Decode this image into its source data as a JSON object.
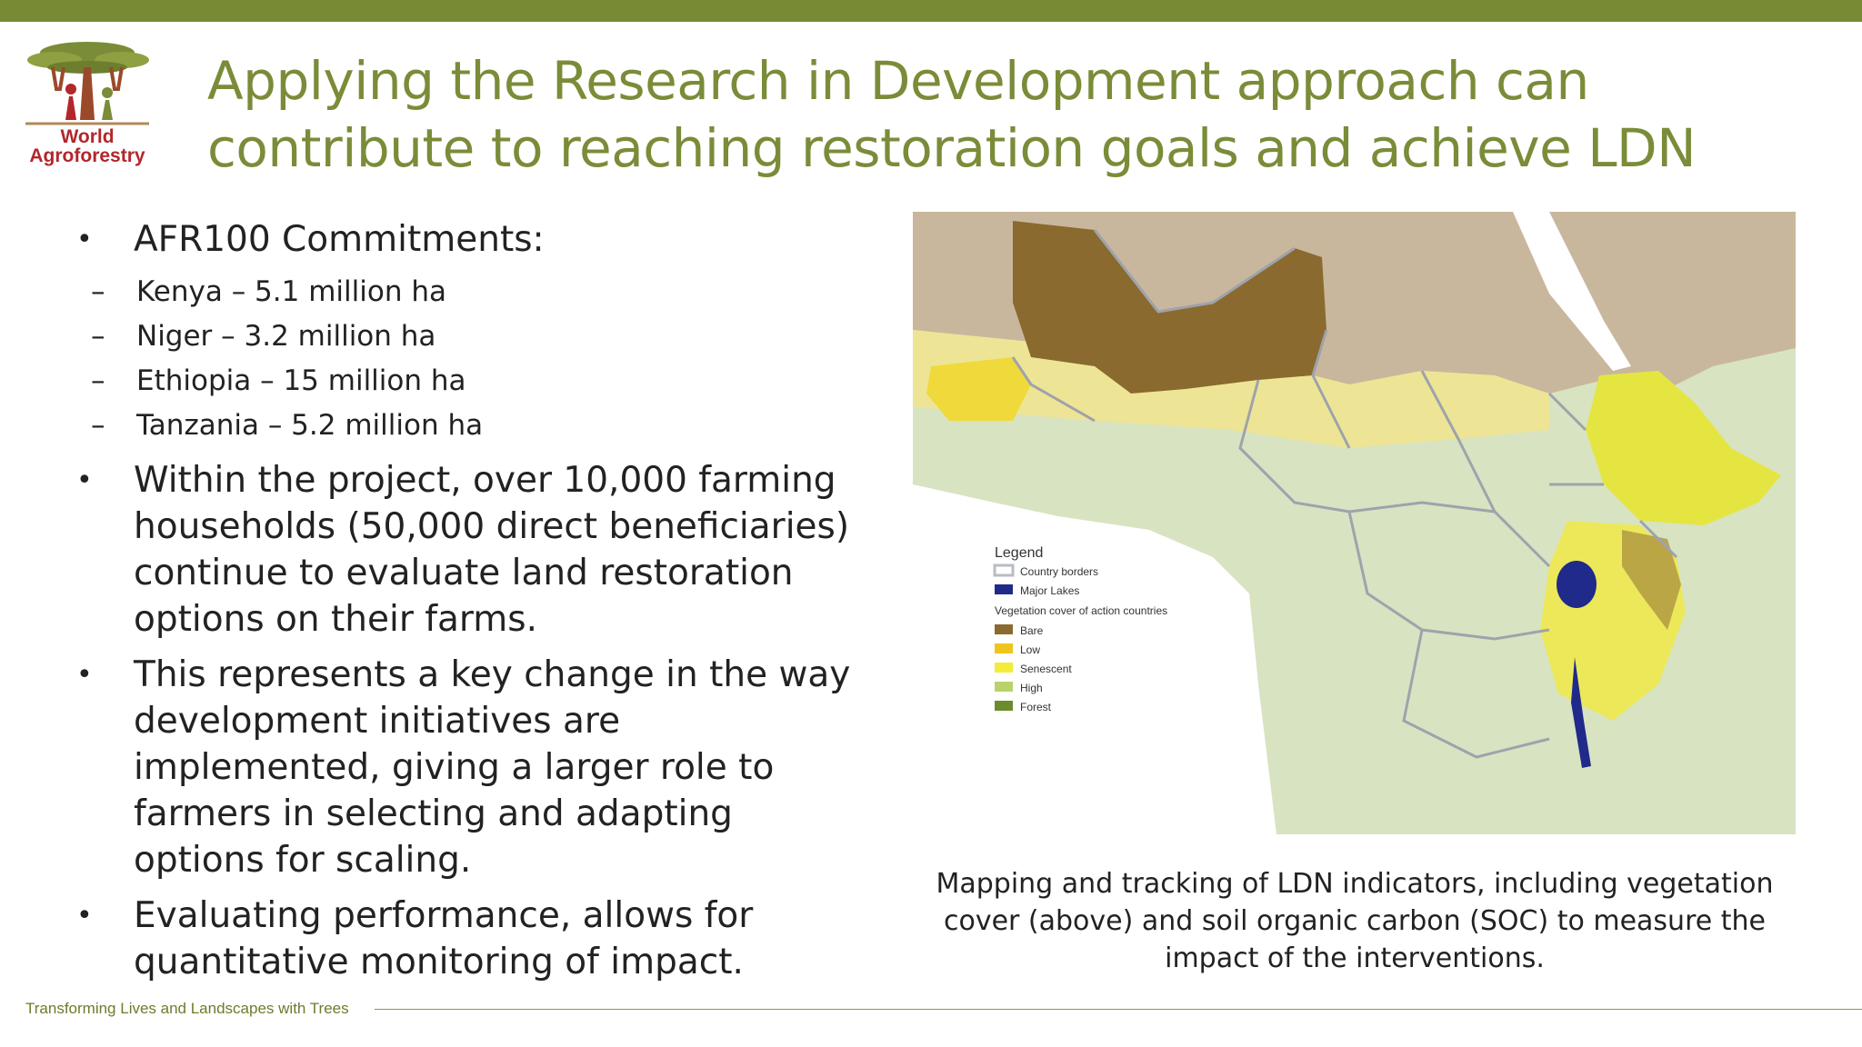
{
  "brand": {
    "logo_line1": "World",
    "logo_line2": "Agroforestry",
    "accent_color": "#788a34",
    "logo_red": "#b3262b"
  },
  "title": {
    "line1": "Applying the Research in Development approach can",
    "line2": "contribute to reaching restoration goals and achieve LDN"
  },
  "bullets": {
    "b1": "AFR100 Commitments:",
    "sub": [
      "Kenya – 5.1  million ha",
      "Niger – 3.2 million ha",
      "Ethiopia – 15 million ha",
      "Tanzania – 5.2 million ha"
    ],
    "b2": "Within the project, over 10,000 farming households (50,000 direct beneficiaries) continue to evaluate land restoration options on their farms.",
    "b3": "This represents a key change in the way development initiatives are implemented, giving a larger role to farmers in selecting and adapting options for scaling.",
    "b4": "Evaluating performance, allows for quantitative monitoring of impact."
  },
  "map": {
    "legend_title": "Legend",
    "legend": [
      {
        "label": "Country borders",
        "color": "#b8bcc4"
      },
      {
        "label": "Major Lakes",
        "color": "#1f2a8a"
      },
      {
        "label": "Vegetation cover of action countries",
        "color": ""
      },
      {
        "label": "Bare",
        "color": "#8a6a2e"
      },
      {
        "label": "Low",
        "color": "#f0c41e"
      },
      {
        "label": "Senescent",
        "color": "#f3ec3a"
      },
      {
        "label": "High",
        "color": "#b9d36a"
      },
      {
        "label": "Forest",
        "color": "#6c8a2e"
      }
    ]
  },
  "caption": "Mapping  and tracking of LDN indicators, including vegetation cover (above) and soil organic carbon (SOC) to measure the impact of the interventions.",
  "footer": "Transforming Lives and Landscapes with Trees"
}
